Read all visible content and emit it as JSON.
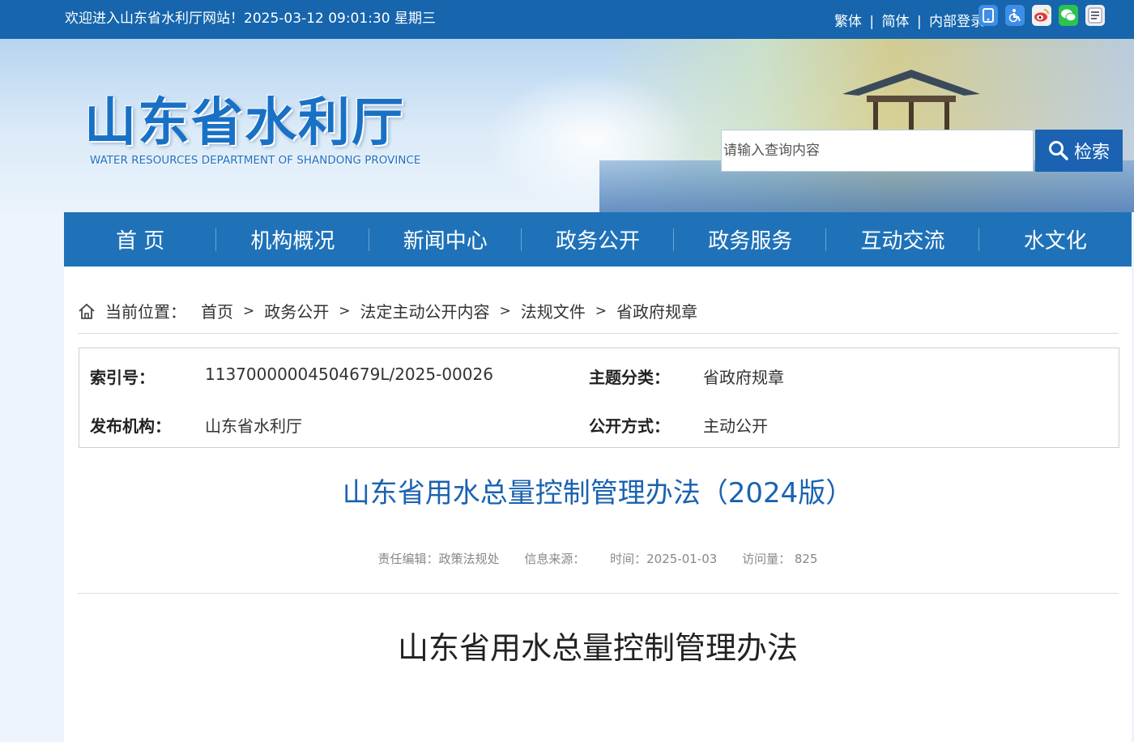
{
  "topbar": {
    "welcome": "欢迎进入山东省水利厅网站！2025-03-12 09:01:30 星期三",
    "links": [
      "繁体",
      "简体",
      "内部登录"
    ],
    "separator": "|",
    "icons": [
      "mobile-icon",
      "accessibility-icon",
      "weibo-icon",
      "wechat-icon",
      "app-icon"
    ]
  },
  "banner": {
    "logo_cn": "山东省水利厅",
    "logo_en": "WATER RESOURCES DEPARTMENT OF SHANDONG PROVINCE",
    "search_placeholder": "请输入查询内容",
    "search_button": "检索"
  },
  "nav": {
    "items": [
      "首 页",
      "机构概况",
      "新闻中心",
      "政务公开",
      "政务服务",
      "互动交流",
      "水文化"
    ]
  },
  "breadcrumb": {
    "label": "当前位置：",
    "items": [
      "首页",
      "政务公开",
      "法定主动公开内容",
      "法规文件",
      "省政府规章"
    ],
    "separator": ">"
  },
  "meta": {
    "index_label": "索引号：",
    "index_value": "11370000004504679L/2025-00026",
    "topic_label": "主题分类：",
    "topic_value": "省政府规章",
    "org_label": "发布机构：",
    "org_value": "山东省水利厅",
    "mode_label": "公开方式：",
    "mode_value": "主动公开"
  },
  "article": {
    "title": "山东省用水总量控制管理办法（2024版）",
    "editor": "责任编辑：政策法规处",
    "source": "信息来源：",
    "time": "时间：2025-01-03",
    "views": "访问量： 825",
    "doc_title": "山东省用水总量控制管理办法"
  },
  "colors": {
    "topbar": "#1665ad",
    "nav": "#1f72b8",
    "title": "#1a62b1"
  }
}
